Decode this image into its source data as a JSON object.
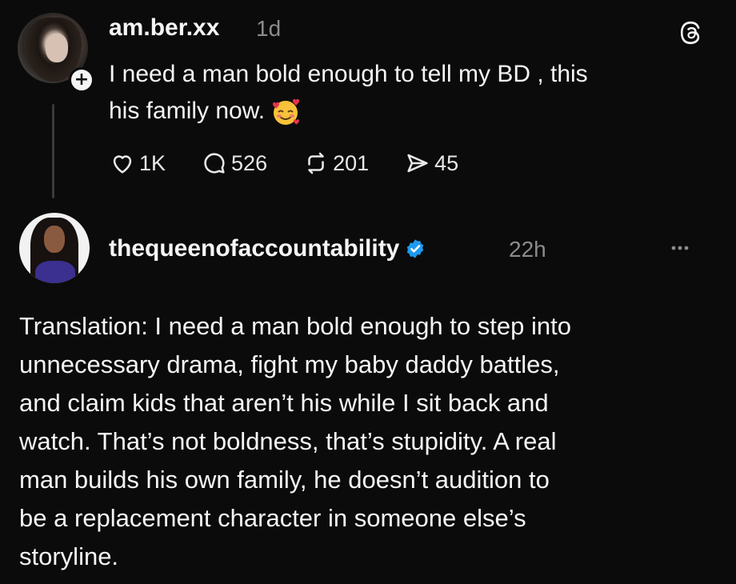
{
  "post1": {
    "username": "am.ber.xx",
    "time": "1d",
    "text_line1": "I need a man bold enough to tell my BD , this",
    "text_line2": "his family now.",
    "emoji": "smiling-face-with-hearts",
    "likes": "1K",
    "replies": "526",
    "reposts": "201",
    "shares": "45"
  },
  "post2": {
    "username": "thequeenofaccountability",
    "time": "22h",
    "lines": [
      "Translation: I need a man bold enough to step into",
      "unnecessary drama, fight my baby daddy battles,",
      "and claim kids that aren’t his while I sit back and",
      "watch. That’s not boldness, that’s stupidity. A real",
      "man builds his own family, he doesn’t audition to",
      "be a replacement character in someone else’s",
      "storyline."
    ]
  },
  "colors": {
    "background": "#0b0b0b",
    "text": "#f5f5f5",
    "muted": "#8c8c8c",
    "verified": "#1d9bf0"
  }
}
